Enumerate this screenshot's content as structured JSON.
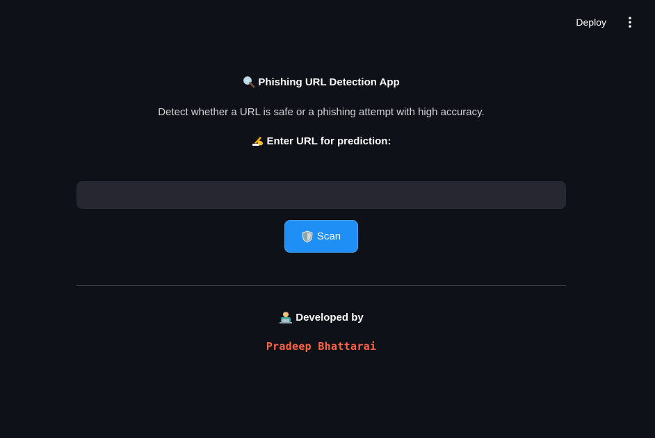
{
  "toolbar": {
    "deploy_label": "Deploy",
    "menu_icon": "vertical-ellipsis-icon"
  },
  "header": {
    "title": "Phishing URL Detection App",
    "title_icon": "magnifier-icon",
    "subtitle": "Detect whether a URL is safe or a phishing attempt with high accuracy."
  },
  "form": {
    "prompt_label": "Enter URL for prediction:",
    "prompt_icon": "writing-hand-icon",
    "url_value": "",
    "url_placeholder": "",
    "scan_label": "Scan",
    "scan_icon": "shield-icon"
  },
  "footer": {
    "developed_by_label": "Developed by",
    "developer_icon": "technologist-icon",
    "developer_name": "Pradeep Bhattarai"
  },
  "colors": {
    "background": "#0e1117",
    "input_background": "#262730",
    "primary_button": "#1f8ef5",
    "developer_name": "#ff6347"
  }
}
